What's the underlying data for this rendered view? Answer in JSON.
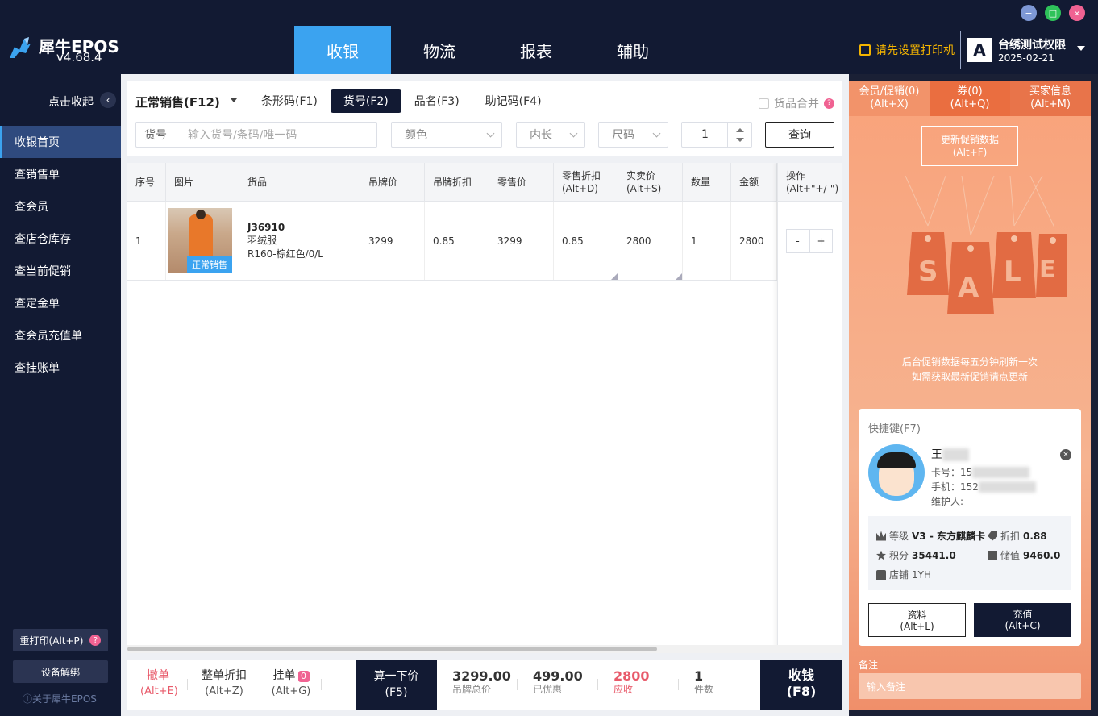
{
  "app": {
    "name": "犀牛EPOS",
    "version": "v4.68.4"
  },
  "window": {
    "min": "−",
    "max": "□",
    "close": "×"
  },
  "main_tabs": [
    "收银",
    "物流",
    "报表",
    "辅助"
  ],
  "printer_warning": "请先设置打印机",
  "user": {
    "avatar_letter": "A",
    "name": "台绣测试权限",
    "date": "2025-02-21"
  },
  "sidebar": {
    "collapse_label": "点击收起",
    "collapse_icon": "‹",
    "items": [
      "收银首页",
      "查销售单",
      "查会员",
      "查店仓库存",
      "查当前促销",
      "查定金单",
      "查会员充值单",
      "查挂账单"
    ],
    "reprint": "重打印(Alt+P)",
    "reprint_help": "?",
    "unbind": "设备解绑",
    "about": "ⓘ关于犀牛EPOS"
  },
  "search": {
    "sale_mode": "正常销售(F12)",
    "tabs": [
      "条形码(F1)",
      "货号(F2)",
      "品名(F3)",
      "助记码(F4)"
    ],
    "merge_label": "货品合并",
    "merge_help": "?",
    "field_label": "货号",
    "field_placeholder": "输入货号/条码/唯一码",
    "color": "颜色",
    "inner_length": "内长",
    "size": "尺码",
    "quantity": "1",
    "query_button": "查询"
  },
  "table": {
    "headers": [
      "序号",
      "图片",
      "货品",
      "吊牌价",
      "吊牌折扣",
      "零售价",
      "零售折扣\n(Alt+D)",
      "实卖价\n(Alt+S)",
      "数量",
      "金额"
    ],
    "ops_header": "操作\n(Alt+\"+/-\")",
    "rows": [
      {
        "index": "1",
        "tag": "正常销售",
        "code": "J36910",
        "name": "羽绒服",
        "spec": "R160-棕红色/0/L",
        "tag_price": "3299",
        "tag_discount": "0.85",
        "retail_price": "3299",
        "retail_discount": "0.85",
        "sale_price": "2800",
        "qty": "1",
        "amount": "2800",
        "minus": "-",
        "plus": "+"
      }
    ]
  },
  "bottom": {
    "cancel": "撤单",
    "cancel_key": "(Alt+E)",
    "whole_discount": "整单折扣",
    "whole_discount_key": "(Alt+Z)",
    "hang": "挂单",
    "hang_count": "0",
    "hang_key": "(Alt+G)",
    "calc": "算一下价",
    "calc_key": "(F5)",
    "tag_total": "3299.00",
    "tag_total_label": "吊牌总价",
    "discounted": "499.00",
    "discounted_label": "已优惠",
    "receivable": "2800",
    "receivable_label": "应收",
    "pieces": "1",
    "pieces_label": "件数",
    "pay": "收钱",
    "pay_key": "(F8)"
  },
  "right_panel": {
    "tabs": [
      {
        "label": "会员/促销(0)",
        "key": "(Alt+X)"
      },
      {
        "label": "券(0)",
        "key": "(Alt+Q)"
      },
      {
        "label": "买家信息",
        "key": "(Alt+M)"
      }
    ],
    "update_promo": "更新促销数据",
    "update_promo_key": "(Alt+F)",
    "sale_letters": [
      "S",
      "A",
      "L",
      "E"
    ],
    "promo_note_1": "后台促销数据每五分钟刷新一次",
    "promo_note_2": "如需获取最新促销请点更新",
    "member": {
      "title": "快捷键(F7)",
      "name_visible": "王",
      "card_label": "卡号：15",
      "phone_label": "手机：152",
      "maintainer": "维护人: --",
      "close": "×",
      "level_label": "等级",
      "level_value": "V3 - 东方麒麟卡",
      "discount_label": "折扣",
      "discount_value": "0.88",
      "points_label": "积分",
      "points_value": "35441.0",
      "balance_label": "储值",
      "balance_value": "9460.0",
      "store_label": "店铺",
      "store_value": "1YH",
      "profile_btn": "资料",
      "profile_key": "(Alt+L)",
      "recharge_btn": "充值",
      "recharge_key": "(Alt+C)"
    },
    "note_label": "备注",
    "note_placeholder": "输入备注"
  },
  "colors": {
    "dark": "#121a33",
    "accent": "#3ba3f0",
    "warning": "#f4b400",
    "danger": "#e85a6a",
    "promo": "#f9a27a"
  }
}
